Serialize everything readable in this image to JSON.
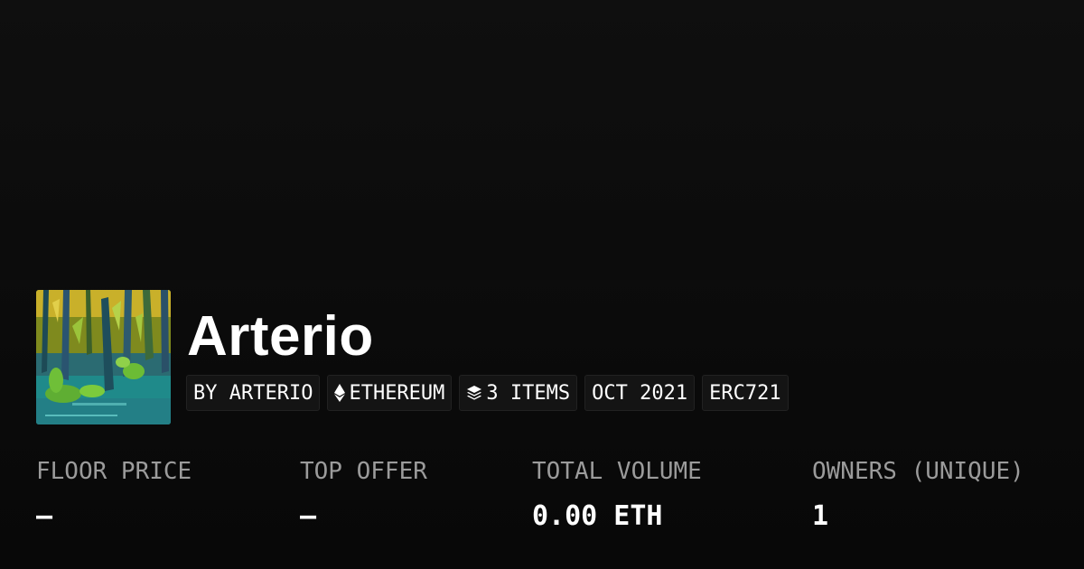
{
  "collection": {
    "name": "Arterio",
    "thumbnail_icon": "painting-thumbnail"
  },
  "tags": [
    {
      "label": "BY ARTERIO",
      "icon": null
    },
    {
      "label": "ETHEREUM",
      "icon": "ethereum-icon"
    },
    {
      "label": "3 ITEMS",
      "icon": "layers-icon"
    },
    {
      "label": "OCT 2021",
      "icon": null
    },
    {
      "label": "ERC721",
      "icon": null
    }
  ],
  "stats": [
    {
      "label": "FLOOR PRICE",
      "value": "–"
    },
    {
      "label": "TOP OFFER",
      "value": "–"
    },
    {
      "label": "TOTAL VOLUME",
      "value": "0.00 ETH"
    },
    {
      "label": "OWNERS (UNIQUE)",
      "value": "1"
    }
  ],
  "colors": {
    "background": "#0a0a0a",
    "label": "#9b9b9b",
    "value": "#ffffff",
    "tag_bg": "#141414"
  }
}
